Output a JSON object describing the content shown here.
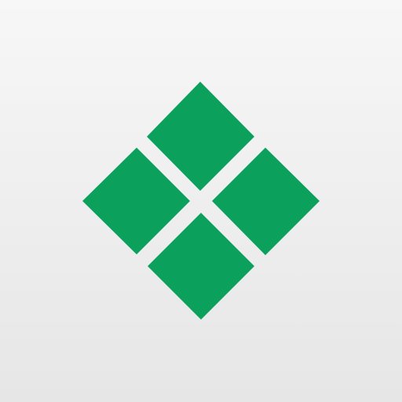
{
  "app_icon": {
    "icon_name": "four-diamond-tiles-logo-icon",
    "colors": {
      "background_top": "#f7f7f7",
      "background_bottom": "#e6e6e6",
      "tile": "#0ba15d"
    },
    "tiles": [
      {
        "name": "tile-top"
      },
      {
        "name": "tile-left"
      },
      {
        "name": "tile-right"
      },
      {
        "name": "tile-bottom"
      }
    ]
  }
}
